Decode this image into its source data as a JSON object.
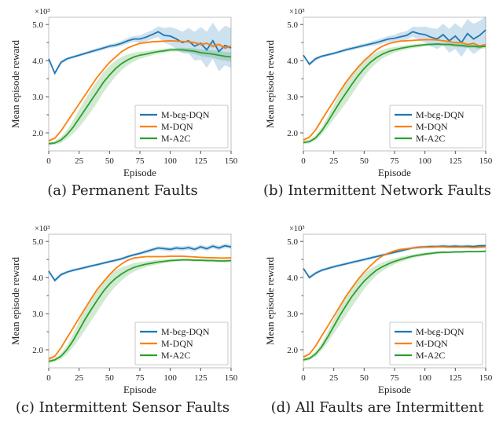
{
  "y_axis_label": "Mean episode reward",
  "x_axis_label": "Episode",
  "x_ticks": [
    0,
    25,
    50,
    75,
    100,
    125,
    150
  ],
  "y_ticks": [
    2.0,
    3.0,
    4.0,
    5.0
  ],
  "y_offset_label": "×10³",
  "legend": {
    "items": [
      {
        "name": "M-bϵg-DQN",
        "color_key": "--blue"
      },
      {
        "name": "M-DQN",
        "color_key": "--orange"
      },
      {
        "name": "M-A2C",
        "color_key": "--green"
      }
    ]
  },
  "panels": [
    {
      "id": "a",
      "caption": "(a) Permanent Faults"
    },
    {
      "id": "b",
      "caption": "(b) Intermittent Network Faults"
    },
    {
      "id": "c",
      "caption": "(c) Intermittent Sensor Faults"
    },
    {
      "id": "d",
      "caption": "(d) All Faults are Intermittent"
    }
  ],
  "chart_data": [
    {
      "panel": "a",
      "type": "line",
      "xlabel": "Episode",
      "ylabel": "Mean episode reward",
      "xlim": [
        0,
        150
      ],
      "ylim": [
        1.5,
        5.2
      ],
      "x": [
        0,
        5,
        10,
        15,
        20,
        25,
        30,
        35,
        40,
        45,
        50,
        55,
        60,
        65,
        70,
        75,
        80,
        85,
        90,
        95,
        100,
        105,
        110,
        115,
        120,
        125,
        130,
        135,
        140,
        145,
        150
      ],
      "series": [
        {
          "name": "M-bϵg-DQN",
          "color": "#1f77b4",
          "values": [
            4.05,
            3.65,
            3.95,
            4.05,
            4.1,
            4.15,
            4.2,
            4.25,
            4.3,
            4.35,
            4.4,
            4.43,
            4.48,
            4.55,
            4.6,
            4.6,
            4.65,
            4.72,
            4.8,
            4.7,
            4.68,
            4.6,
            4.5,
            4.55,
            4.4,
            4.48,
            4.3,
            4.55,
            4.25,
            4.42,
            4.35
          ],
          "band": [
            0.02,
            0.05,
            0.05,
            0.04,
            0.04,
            0.04,
            0.04,
            0.05,
            0.05,
            0.05,
            0.05,
            0.06,
            0.07,
            0.08,
            0.08,
            0.1,
            0.12,
            0.12,
            0.15,
            0.2,
            0.25,
            0.28,
            0.3,
            0.35,
            0.4,
            0.45,
            0.5,
            0.5,
            0.55,
            0.55,
            0.55
          ]
        },
        {
          "name": "M-DQN",
          "color": "#ff7f0e",
          "values": [
            1.78,
            1.85,
            2.05,
            2.3,
            2.55,
            2.8,
            3.05,
            3.3,
            3.55,
            3.75,
            3.95,
            4.1,
            4.25,
            4.35,
            4.42,
            4.48,
            4.5,
            4.52,
            4.53,
            4.54,
            4.55,
            4.54,
            4.53,
            4.52,
            4.5,
            4.45,
            4.48,
            4.4,
            4.45,
            4.35,
            4.4
          ],
          "band": [
            0.04,
            0.03,
            0.03,
            0.03,
            0.03,
            0.02,
            0.02,
            0.02,
            0.02,
            0.02,
            0.02,
            0.02,
            0.02,
            0.02,
            0.02,
            0.02,
            0.02,
            0.02,
            0.02,
            0.02,
            0.02,
            0.02,
            0.02,
            0.03,
            0.03,
            0.04,
            0.03,
            0.05,
            0.04,
            0.04,
            0.04
          ]
        },
        {
          "name": "M-A2C",
          "color": "#2ca02c",
          "values": [
            1.7,
            1.72,
            1.8,
            1.95,
            2.15,
            2.4,
            2.65,
            2.9,
            3.15,
            3.4,
            3.6,
            3.78,
            3.92,
            4.02,
            4.1,
            4.15,
            4.18,
            4.22,
            4.25,
            4.27,
            4.3,
            4.3,
            4.3,
            4.28,
            4.26,
            4.22,
            4.2,
            4.18,
            4.15,
            4.12,
            4.1
          ],
          "band": [
            0.05,
            0.05,
            0.08,
            0.12,
            0.18,
            0.25,
            0.28,
            0.3,
            0.3,
            0.28,
            0.25,
            0.22,
            0.18,
            0.15,
            0.12,
            0.1,
            0.08,
            0.07,
            0.06,
            0.06,
            0.05,
            0.05,
            0.06,
            0.07,
            0.08,
            0.09,
            0.1,
            0.1,
            0.12,
            0.12,
            0.13
          ]
        }
      ]
    },
    {
      "panel": "b",
      "type": "line",
      "xlabel": "Episode",
      "ylabel": "Mean episode reward",
      "xlim": [
        0,
        150
      ],
      "ylim": [
        1.5,
        5.2
      ],
      "x": [
        0,
        5,
        10,
        15,
        20,
        25,
        30,
        35,
        40,
        45,
        50,
        55,
        60,
        65,
        70,
        75,
        80,
        85,
        90,
        95,
        100,
        105,
        110,
        115,
        120,
        125,
        130,
        135,
        140,
        145,
        150
      ],
      "series": [
        {
          "name": "M-bϵg-DQN",
          "color": "#1f77b4",
          "values": [
            4.15,
            3.9,
            4.05,
            4.12,
            4.16,
            4.2,
            4.25,
            4.3,
            4.34,
            4.38,
            4.42,
            4.46,
            4.5,
            4.55,
            4.6,
            4.62,
            4.66,
            4.7,
            4.8,
            4.75,
            4.72,
            4.65,
            4.6,
            4.72,
            4.55,
            4.68,
            4.5,
            4.75,
            4.6,
            4.7,
            4.85
          ],
          "band": [
            0.02,
            0.05,
            0.05,
            0.04,
            0.04,
            0.04,
            0.04,
            0.05,
            0.05,
            0.05,
            0.05,
            0.06,
            0.07,
            0.08,
            0.08,
            0.1,
            0.12,
            0.12,
            0.14,
            0.18,
            0.22,
            0.25,
            0.28,
            0.3,
            0.33,
            0.36,
            0.4,
            0.4,
            0.42,
            0.4,
            0.38
          ]
        },
        {
          "name": "M-DQN",
          "color": "#ff7f0e",
          "values": [
            1.8,
            1.88,
            2.08,
            2.35,
            2.62,
            2.88,
            3.15,
            3.4,
            3.62,
            3.82,
            4.0,
            4.15,
            4.3,
            4.4,
            4.47,
            4.51,
            4.54,
            4.55,
            4.56,
            4.57,
            4.58,
            4.58,
            4.57,
            4.55,
            4.53,
            4.5,
            4.5,
            4.45,
            4.48,
            4.4,
            4.45
          ],
          "band": [
            0.04,
            0.03,
            0.03,
            0.03,
            0.03,
            0.02,
            0.02,
            0.02,
            0.02,
            0.02,
            0.02,
            0.02,
            0.02,
            0.02,
            0.02,
            0.02,
            0.02,
            0.02,
            0.02,
            0.02,
            0.02,
            0.02,
            0.02,
            0.02,
            0.02,
            0.02,
            0.02,
            0.02,
            0.02,
            0.02,
            0.02
          ]
        },
        {
          "name": "M-A2C",
          "color": "#2ca02c",
          "values": [
            1.73,
            1.76,
            1.86,
            2.05,
            2.3,
            2.58,
            2.85,
            3.1,
            3.35,
            3.58,
            3.78,
            3.95,
            4.08,
            4.18,
            4.25,
            4.3,
            4.34,
            4.37,
            4.4,
            4.42,
            4.44,
            4.45,
            4.46,
            4.45,
            4.45,
            4.43,
            4.42,
            4.4,
            4.4,
            4.38,
            4.4
          ],
          "band": [
            0.05,
            0.05,
            0.07,
            0.1,
            0.15,
            0.2,
            0.25,
            0.28,
            0.28,
            0.26,
            0.22,
            0.18,
            0.15,
            0.12,
            0.1,
            0.08,
            0.07,
            0.06,
            0.05,
            0.05,
            0.04,
            0.04,
            0.04,
            0.04,
            0.05,
            0.05,
            0.05,
            0.05,
            0.05,
            0.06,
            0.06
          ]
        }
      ]
    },
    {
      "panel": "c",
      "type": "line",
      "xlabel": "Episode",
      "ylabel": "Mean episode reward",
      "xlim": [
        0,
        150
      ],
      "ylim": [
        1.5,
        5.2
      ],
      "x": [
        0,
        5,
        10,
        15,
        20,
        25,
        30,
        35,
        40,
        45,
        50,
        55,
        60,
        65,
        70,
        75,
        80,
        85,
        90,
        95,
        100,
        105,
        110,
        115,
        120,
        125,
        130,
        135,
        140,
        145,
        150
      ],
      "series": [
        {
          "name": "M-bϵg-DQN",
          "color": "#1f77b4",
          "values": [
            4.18,
            3.92,
            4.08,
            4.15,
            4.2,
            4.24,
            4.28,
            4.32,
            4.36,
            4.4,
            4.44,
            4.48,
            4.52,
            4.58,
            4.63,
            4.67,
            4.72,
            4.77,
            4.82,
            4.8,
            4.78,
            4.82,
            4.8,
            4.83,
            4.78,
            4.85,
            4.8,
            4.87,
            4.82,
            4.88,
            4.85
          ],
          "band": [
            0.02,
            0.05,
            0.05,
            0.04,
            0.04,
            0.04,
            0.04,
            0.04,
            0.04,
            0.04,
            0.04,
            0.04,
            0.04,
            0.04,
            0.04,
            0.04,
            0.05,
            0.05,
            0.05,
            0.06,
            0.06,
            0.06,
            0.06,
            0.06,
            0.06,
            0.06,
            0.06,
            0.06,
            0.06,
            0.06,
            0.06
          ]
        },
        {
          "name": "M-DQN",
          "color": "#ff7f0e",
          "values": [
            1.75,
            1.82,
            2.05,
            2.33,
            2.6,
            2.88,
            3.15,
            3.42,
            3.68,
            3.88,
            4.08,
            4.25,
            4.38,
            4.48,
            4.54,
            4.56,
            4.58,
            4.58,
            4.58,
            4.58,
            4.59,
            4.59,
            4.59,
            4.58,
            4.57,
            4.56,
            4.55,
            4.55,
            4.54,
            4.54,
            4.55
          ],
          "band": [
            0.04,
            0.03,
            0.03,
            0.03,
            0.03,
            0.02,
            0.02,
            0.02,
            0.02,
            0.02,
            0.02,
            0.02,
            0.02,
            0.02,
            0.02,
            0.02,
            0.02,
            0.02,
            0.02,
            0.02,
            0.02,
            0.02,
            0.02,
            0.02,
            0.02,
            0.02,
            0.02,
            0.02,
            0.02,
            0.02,
            0.02
          ]
        },
        {
          "name": "M-A2C",
          "color": "#2ca02c",
          "values": [
            1.68,
            1.72,
            1.82,
            2.0,
            2.25,
            2.55,
            2.85,
            3.12,
            3.38,
            3.62,
            3.82,
            3.98,
            4.1,
            4.2,
            4.28,
            4.33,
            4.37,
            4.4,
            4.43,
            4.45,
            4.47,
            4.48,
            4.49,
            4.49,
            4.48,
            4.48,
            4.47,
            4.47,
            4.46,
            4.46,
            4.47
          ],
          "band": [
            0.05,
            0.05,
            0.08,
            0.12,
            0.18,
            0.25,
            0.3,
            0.32,
            0.32,
            0.3,
            0.26,
            0.22,
            0.18,
            0.14,
            0.12,
            0.1,
            0.08,
            0.07,
            0.06,
            0.05,
            0.05,
            0.04,
            0.04,
            0.04,
            0.04,
            0.04,
            0.04,
            0.04,
            0.04,
            0.04,
            0.04
          ]
        }
      ]
    },
    {
      "panel": "d",
      "type": "line",
      "xlabel": "Episode",
      "ylabel": "Mean episode reward",
      "xlim": [
        0,
        150
      ],
      "ylim": [
        1.5,
        5.2
      ],
      "x": [
        0,
        5,
        10,
        15,
        20,
        25,
        30,
        35,
        40,
        45,
        50,
        55,
        60,
        65,
        70,
        75,
        80,
        85,
        90,
        95,
        100,
        105,
        110,
        115,
        120,
        125,
        130,
        135,
        140,
        145,
        150
      ],
      "series": [
        {
          "name": "M-bϵg-DQN",
          "color": "#1f77b4",
          "values": [
            4.25,
            4.0,
            4.12,
            4.2,
            4.25,
            4.3,
            4.34,
            4.38,
            4.42,
            4.46,
            4.5,
            4.54,
            4.58,
            4.62,
            4.66,
            4.7,
            4.74,
            4.78,
            4.82,
            4.84,
            4.85,
            4.86,
            4.86,
            4.87,
            4.86,
            4.87,
            4.86,
            4.87,
            4.86,
            4.88,
            4.88
          ],
          "band": [
            0.02,
            0.05,
            0.05,
            0.04,
            0.04,
            0.04,
            0.04,
            0.04,
            0.04,
            0.04,
            0.04,
            0.04,
            0.04,
            0.04,
            0.04,
            0.04,
            0.04,
            0.04,
            0.04,
            0.04,
            0.04,
            0.04,
            0.04,
            0.04,
            0.04,
            0.04,
            0.04,
            0.04,
            0.04,
            0.04,
            0.04
          ]
        },
        {
          "name": "M-DQN",
          "color": "#ff7f0e",
          "values": [
            1.8,
            1.88,
            2.1,
            2.38,
            2.65,
            2.93,
            3.2,
            3.48,
            3.72,
            3.95,
            4.15,
            4.32,
            4.48,
            4.6,
            4.68,
            4.74,
            4.78,
            4.8,
            4.82,
            4.83,
            4.84,
            4.84,
            4.85,
            4.85,
            4.84,
            4.84,
            4.84,
            4.84,
            4.83,
            4.84,
            4.85
          ],
          "band": [
            0.04,
            0.03,
            0.03,
            0.03,
            0.03,
            0.02,
            0.02,
            0.02,
            0.02,
            0.02,
            0.02,
            0.02,
            0.02,
            0.02,
            0.02,
            0.02,
            0.02,
            0.02,
            0.02,
            0.02,
            0.02,
            0.02,
            0.02,
            0.02,
            0.02,
            0.02,
            0.02,
            0.02,
            0.02,
            0.02,
            0.02
          ]
        },
        {
          "name": "M-A2C",
          "color": "#2ca02c",
          "values": [
            1.72,
            1.76,
            1.88,
            2.08,
            2.35,
            2.65,
            2.95,
            3.22,
            3.48,
            3.7,
            3.9,
            4.06,
            4.2,
            4.3,
            4.38,
            4.45,
            4.5,
            4.55,
            4.59,
            4.62,
            4.65,
            4.67,
            4.69,
            4.7,
            4.7,
            4.71,
            4.71,
            4.72,
            4.72,
            4.72,
            4.73
          ],
          "band": [
            0.05,
            0.05,
            0.07,
            0.1,
            0.15,
            0.2,
            0.25,
            0.28,
            0.28,
            0.26,
            0.22,
            0.18,
            0.14,
            0.12,
            0.1,
            0.08,
            0.07,
            0.06,
            0.05,
            0.05,
            0.04,
            0.04,
            0.04,
            0.04,
            0.03,
            0.03,
            0.03,
            0.03,
            0.03,
            0.03,
            0.03
          ]
        }
      ]
    }
  ]
}
